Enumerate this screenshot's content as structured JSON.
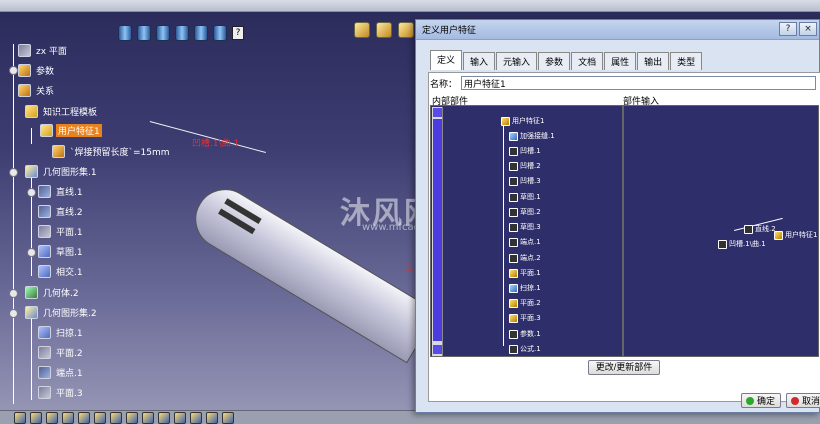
{
  "tree": {
    "nodes": [
      {
        "label": "zx 平面"
      },
      {
        "label": "参数"
      },
      {
        "label": "关系"
      },
      {
        "label": "知识工程模板"
      },
      {
        "label": "用户特征1"
      },
      {
        "label": "`焊接预留长度`=15mm"
      },
      {
        "label": "几何图形集.1"
      },
      {
        "label": "直线.1"
      },
      {
        "label": "直线.2"
      },
      {
        "label": "平面.1"
      },
      {
        "label": "草图.1"
      },
      {
        "label": "相交.1"
      },
      {
        "label": "几何体.2"
      },
      {
        "label": "几何图形集.2"
      },
      {
        "label": "扫掠.1"
      },
      {
        "label": "平面.2"
      },
      {
        "label": "端点.1"
      },
      {
        "label": "平面.3"
      }
    ]
  },
  "viewport": {
    "annotation_label": "凹槽.1\\曲.1",
    "annotation2_label": "互",
    "watermark": "沐风网",
    "watermark_sub": "www.mfcad.com"
  },
  "dialog": {
    "title": "定义用户特征",
    "help_btn": "?",
    "close_btn": "×",
    "tabs": [
      "定义",
      "输入",
      "元输入",
      "参数",
      "文档",
      "属性",
      "输出",
      "类型"
    ],
    "name_label": "名称：",
    "name_value": "用户特征1",
    "internal_label": "内部部件",
    "input_label": "部件输入",
    "internal_nodes": [
      {
        "label": "用户特征1"
      },
      {
        "label": "加强接缝.1"
      },
      {
        "label": "凹槽.1"
      },
      {
        "label": "凹槽.2"
      },
      {
        "label": "凹槽.3"
      },
      {
        "label": "草图.1"
      },
      {
        "label": "草图.2"
      },
      {
        "label": "草图.3"
      },
      {
        "label": "端点.1"
      },
      {
        "label": "端点.2"
      },
      {
        "label": "平面.1"
      },
      {
        "label": "扫掠.1"
      },
      {
        "label": "平面.2"
      },
      {
        "label": "平面.3"
      },
      {
        "label": "参数.1"
      },
      {
        "label": "公式.1"
      }
    ],
    "input_nodes": [
      {
        "label": "直线.2"
      },
      {
        "label": "用户特征1"
      },
      {
        "label": "凹槽.1\\曲.1"
      }
    ],
    "update_button": "更改/更新部件",
    "ok_button": "确定",
    "cancel_button": "取消"
  }
}
